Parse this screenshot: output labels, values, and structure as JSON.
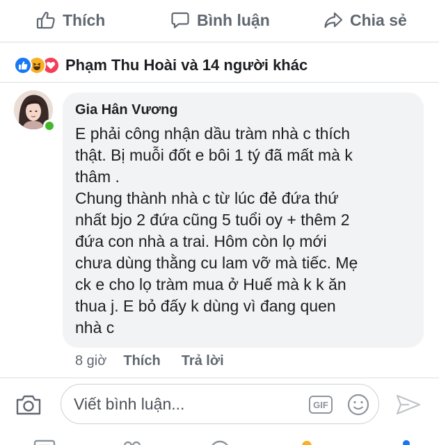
{
  "actions": {
    "like_label": "Thích",
    "comment_label": "Bình luận",
    "share_label": "Chia sẻ"
  },
  "reactions": {
    "summary": "Phạm Thu Hoài và 14 người khác",
    "types": [
      "like-icon",
      "haha-icon",
      "love-icon"
    ]
  },
  "comment": {
    "author": "Gia Hân Vương",
    "lines": [
      "E phải công nhận dầu tràm nhà c thích",
      "thật. Bị muỗi đốt e bôi 1 tý đã mất mà k",
      "thâm .",
      "Chung thành nhà c từ lúc đẻ đứa thứ",
      "nhất bjo 2 đứa cũng 5 tuổi oy + thêm 2",
      "đứa con nhà a trai. Hôm còn lọ mới",
      "chưa dùng thằng cu lam vỡ mà tiếc. Mẹ",
      "ck e cho lọ tràm mua ở Huế mà k k ăn",
      "thua j. E bỏ đấy k dùng vì đang quen",
      "nhà c"
    ],
    "time": "8 giờ",
    "like_label": "Thích",
    "reply_label": "Trả lời"
  },
  "composer": {
    "placeholder": "Viết bình luận...",
    "gif_label": "GIF"
  },
  "colors": {
    "accent": "#1877f2",
    "muted_text": "#606770",
    "bubble_bg": "#f2f3f5",
    "online": "#42b72a"
  }
}
